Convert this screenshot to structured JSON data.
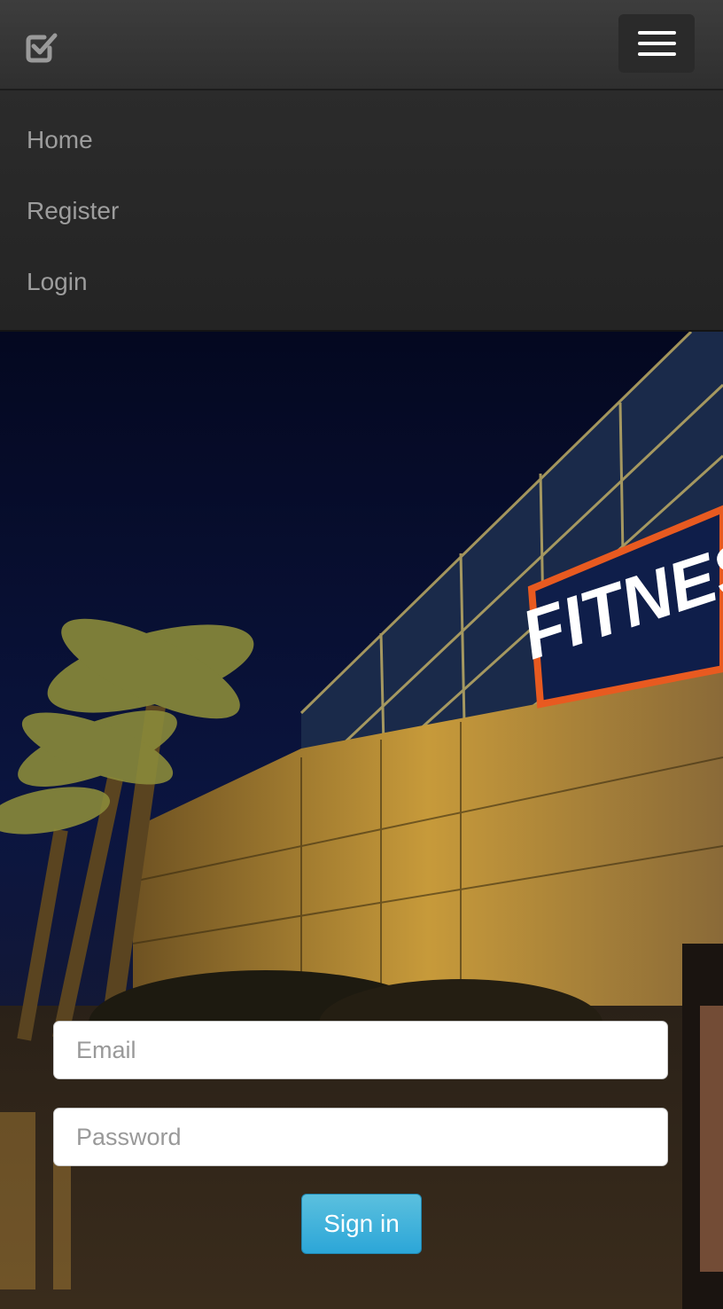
{
  "navbar": {
    "brand_icon": "checkbox-check-icon",
    "toggle_icon": "hamburger-menu-icon"
  },
  "menu": {
    "items": [
      {
        "label": "Home"
      },
      {
        "label": "Register"
      },
      {
        "label": "Login"
      }
    ]
  },
  "hero": {
    "background": "night-photo-of-fitness-club-building-with-palm-trees",
    "sign_text": "FITNESS"
  },
  "form": {
    "email_placeholder": "Email",
    "password_placeholder": "Password",
    "signin_label": "Sign in"
  },
  "colors": {
    "navbar": "#353535",
    "menu_text": "#9d9d9d",
    "button": "#39b3d7"
  }
}
